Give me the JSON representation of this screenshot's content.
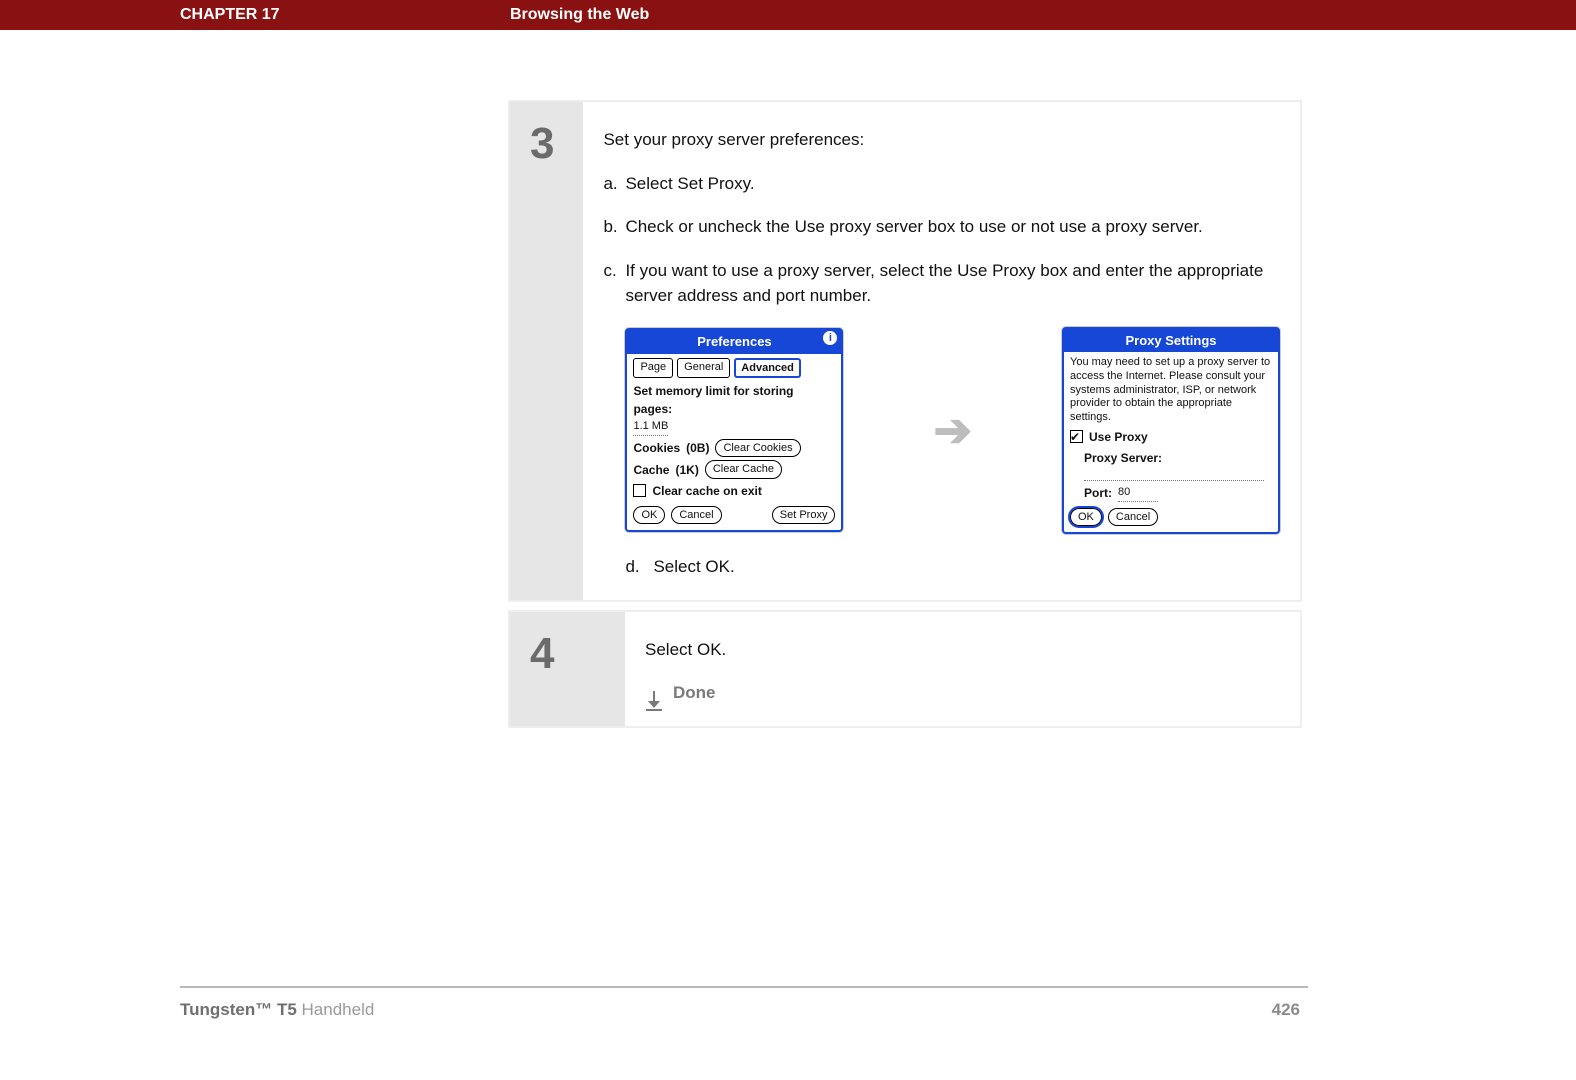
{
  "header": {
    "chapter": "CHAPTER 17",
    "title": "Browsing the Web"
  },
  "steps": {
    "s3": {
      "num": "3",
      "lead": "Set your proxy server preferences:",
      "items": [
        {
          "l": "a.",
          "t": "Select Set Proxy."
        },
        {
          "l": "b.",
          "t": "Check or uncheck the Use proxy server box to use or not use a proxy server."
        },
        {
          "l": "c.",
          "t": "If you want to use a proxy server, select the Use Proxy box and enter the appropriate server address and port number."
        }
      ],
      "after": {
        "l": "d.",
        "t": "Select OK."
      }
    },
    "s4": {
      "num": "4",
      "text": "Select OK.",
      "done": "Done"
    }
  },
  "prefs": {
    "title": "Preferences",
    "tabs": {
      "page": "Page",
      "general": "General",
      "advanced": "Advanced"
    },
    "mem_label": "Set memory limit for storing pages:",
    "mem_value": "1.1 MB",
    "cookies_label": "Cookies",
    "cookies_size": "(0B)",
    "clear_cookies": "Clear Cookies",
    "cache_label": "Cache",
    "cache_size": "(1K)",
    "clear_cache": "Clear Cache",
    "clear_on_exit": "Clear cache on exit",
    "ok": "OK",
    "cancel": "Cancel",
    "set_proxy": "Set Proxy"
  },
  "proxy": {
    "title": "Proxy Settings",
    "help": "You may need to set up a proxy server to access the Internet. Please consult your systems administrator, ISP, or network provider to obtain the appropriate settings.",
    "use_proxy": "Use Proxy",
    "server_label": "Proxy Server:",
    "port_label": "Port:",
    "port_value": "80",
    "ok": "OK",
    "cancel": "Cancel"
  },
  "footer": {
    "brand_bold": "Tungsten™ T5",
    "brand_light": " Handheld",
    "page": "426"
  }
}
